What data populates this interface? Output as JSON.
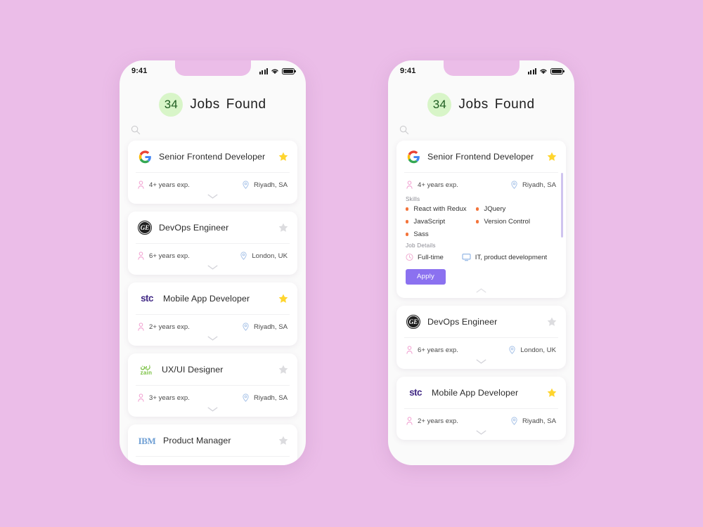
{
  "background_color": "#ebbde8",
  "accent": {
    "badge_bg": "#d8f5c8",
    "badge_text": "#1f5d21",
    "star_active": "#ffd52e",
    "star_inactive": "#dcdcdf",
    "apply_bg": "#8b71f0",
    "skill_dot": "#f4743b",
    "person_icon": "#f19ed0",
    "pin_icon": "#a8c3e8",
    "scrollbar": "#cfc4ef"
  },
  "status_bar": {
    "time": "9:41",
    "signal_icon": "cellular-bars-icon",
    "wifi_icon": "wifi-icon",
    "battery_icon": "battery-full-icon"
  },
  "header": {
    "count": "34",
    "title": "Jobs  Found",
    "search_icon": "search-icon",
    "search_placeholder": "Search"
  },
  "labels": {
    "skills": "Skills",
    "job_details": "Job Details",
    "apply": "Apply",
    "expand_icon": "chevron-down-icon",
    "collapse_icon": "chevron-up-icon",
    "exp_icon": "person-icon",
    "location_icon": "map-pin-icon",
    "employment_icon": "clock-icon",
    "industry_icon": "monitor-icon"
  },
  "phone_left": {
    "jobs": [
      {
        "logo": "google-logo",
        "title": "Senior Frontend Developer",
        "starred": true,
        "experience": "4+ years exp.",
        "location": "Riyadh, SA"
      },
      {
        "logo": "ge-logo",
        "title": "DevOps Engineer",
        "starred": false,
        "experience": "6+ years exp.",
        "location": "London, UK"
      },
      {
        "logo": "stc-logo",
        "title": "Mobile App Developer",
        "starred": true,
        "experience": "2+ years exp.",
        "location": "Riyadh, SA"
      },
      {
        "logo": "zain-logo",
        "title": "UX/UI Designer",
        "starred": false,
        "experience": "3+ years exp.",
        "location": "Riyadh, SA"
      },
      {
        "logo": "ibm-logo",
        "title": "Product Manager",
        "starred": false,
        "experience": "",
        "location": ""
      }
    ]
  },
  "phone_right": {
    "expanded_job": {
      "logo": "google-logo",
      "title": "Senior Frontend Developer",
      "starred": true,
      "experience": "4+ years exp.",
      "location": "Riyadh, SA",
      "skills": [
        "React with Redux",
        "JQuery",
        "JavaScript",
        "Version Control",
        "Sass"
      ],
      "employment_type": "Full-time",
      "industry": "IT, product development",
      "apply_label": "Apply"
    },
    "jobs": [
      {
        "logo": "ge-logo",
        "title": "DevOps Engineer",
        "starred": false,
        "experience": "6+ years exp.",
        "location": "London, UK"
      },
      {
        "logo": "stc-logo",
        "title": "Mobile App Developer",
        "starred": true,
        "experience": "2+ years exp.",
        "location": "Riyadh, SA"
      }
    ]
  },
  "brand_text": {
    "ibm": "IBM",
    "stc": "stc",
    "zain_ar": "زين",
    "zain_en": "zain",
    "ge": "GE"
  }
}
